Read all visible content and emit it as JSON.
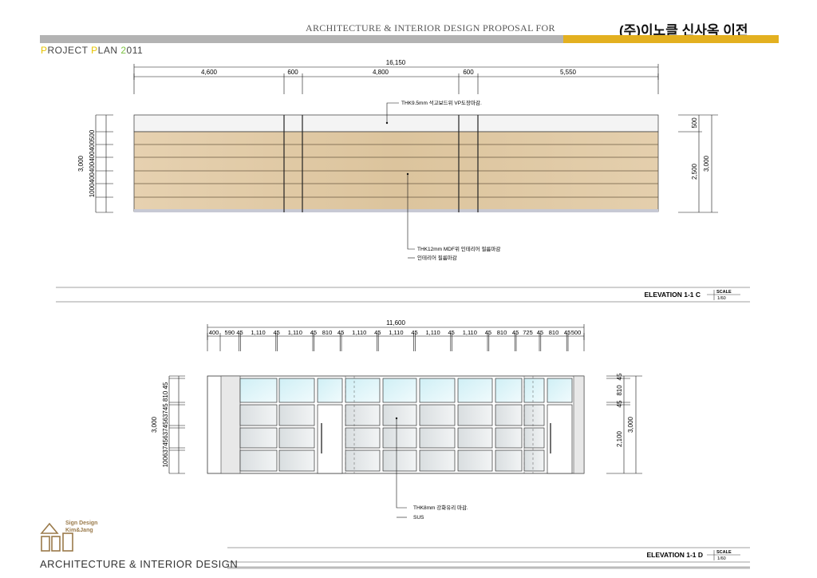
{
  "header": {
    "proposal_title": "ARCHITECTURE & INTERIOR DESIGN PROPOSAL FOR",
    "client": "(주)이노클 신사옥 이전",
    "project_plan": {
      "p1": "P",
      "t1": "ROJECT ",
      "p2": "P",
      "t2": "LAN ",
      "p3": "2",
      "t3": "011"
    },
    "accent_gray": "#b3b3b3",
    "accent_gold": "#e3b020"
  },
  "elevation_c": {
    "title": "ELEVATION 1-1 C",
    "scale_label": "SCALE",
    "scale_value": "1/60",
    "overall_dim": "16,150",
    "segment_dims": [
      "4,600",
      "600",
      "4,800",
      "600",
      "5,550"
    ],
    "left_height": "3,000",
    "left_stack": "1000400400400400500",
    "right_dims": [
      "500",
      "2,500",
      "3,000"
    ],
    "note_top": "THK9.5mm 석고보드위 VP도장마감.",
    "note_bottom_1": "THK12mm MDF위 인테리어 필름마감",
    "note_bottom_2": "인테리어 필름마감"
  },
  "elevation_d": {
    "title": "ELEVATION 1-1 D",
    "scale_label": "SCALE",
    "scale_value": "1/60",
    "overall_dim": "11,600",
    "segment_dims": [
      "400",
      "590",
      "45",
      "1,110",
      "45",
      "1,110",
      "45",
      "810",
      "45",
      "1,110",
      "45",
      "1,110",
      "45",
      "1,110",
      "45",
      "1,110",
      "45",
      "810",
      "45",
      "725",
      "45",
      "810",
      "45",
      "500"
    ],
    "left_height": "3,000",
    "left_stack": "100637456374563745 810 45",
    "right_dims": [
      "45",
      "810",
      "45",
      "2,100",
      "3,000"
    ],
    "note_1": "THK8mm 강화유리 마감.",
    "note_2": "SUS"
  },
  "footer": {
    "company": "ARCHITECTURE & INTERIOR DESIGN",
    "logo_line1": "Sign Design",
    "logo_line2": "Kim&Jang"
  }
}
